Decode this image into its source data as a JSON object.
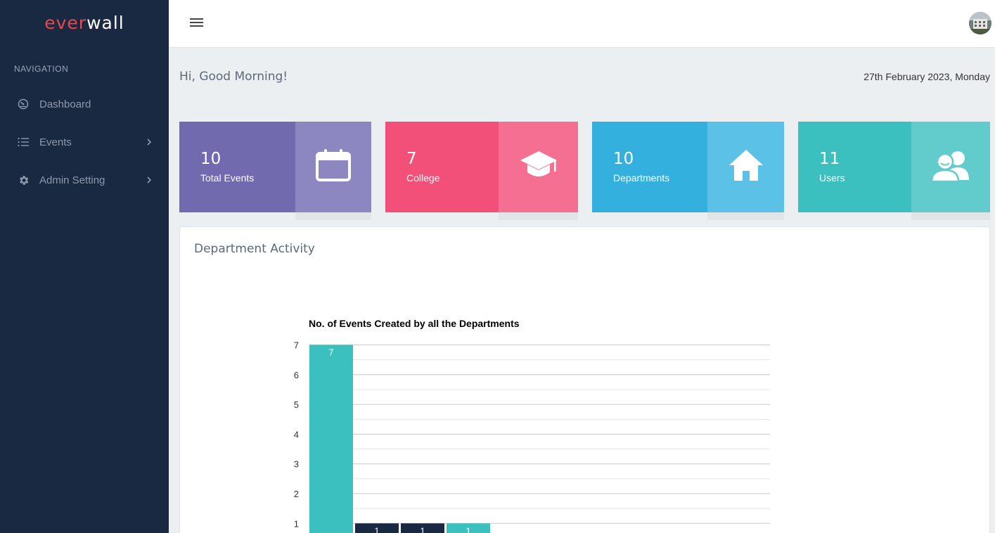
{
  "brand": {
    "part1": "ever",
    "part2": "wall"
  },
  "sidebar": {
    "section_title": "NAVIGATION",
    "items": [
      {
        "label": "Dashboard",
        "icon": "gauge-icon"
      },
      {
        "label": "Events",
        "icon": "list-icon",
        "has_submenu": true
      },
      {
        "label": "Admin Setting",
        "icon": "gear-icon",
        "has_submenu": true
      }
    ]
  },
  "header": {
    "greeting": "Hi, Good Morning!",
    "date": "27th February 2023, Monday"
  },
  "stats": [
    {
      "value": "10",
      "label": "Total Events",
      "icon": "calendar-icon",
      "color": "#716aae",
      "icon_bg": "#8c87c0"
    },
    {
      "value": "7",
      "label": "College",
      "icon": "graduation-cap-icon",
      "color": "#f25078",
      "icon_bg": "#f46f92"
    },
    {
      "value": "10",
      "label": "Departments",
      "icon": "home-icon",
      "color": "#34b0df",
      "icon_bg": "#5cc1e6"
    },
    {
      "value": "11",
      "label": "Users",
      "icon": "users-icon",
      "color": "#3bbfbf",
      "icon_bg": "#62cccc"
    }
  ],
  "activity": {
    "title": "Department Activity",
    "chart_data": {
      "type": "bar",
      "title": "No. of Events Created by all the Departments",
      "xlabel": "",
      "ylabel": "",
      "ylim": [
        0,
        7
      ],
      "yticks": [
        1,
        2,
        3,
        4,
        5,
        6,
        7
      ],
      "grid": true,
      "values": [
        7,
        1,
        1,
        1
      ],
      "colors": [
        "#3bbfbf",
        "#1a2942",
        "#1a2942",
        "#3bbfbf"
      ],
      "data_labels": [
        "7",
        "1",
        "1",
        "1"
      ]
    }
  }
}
